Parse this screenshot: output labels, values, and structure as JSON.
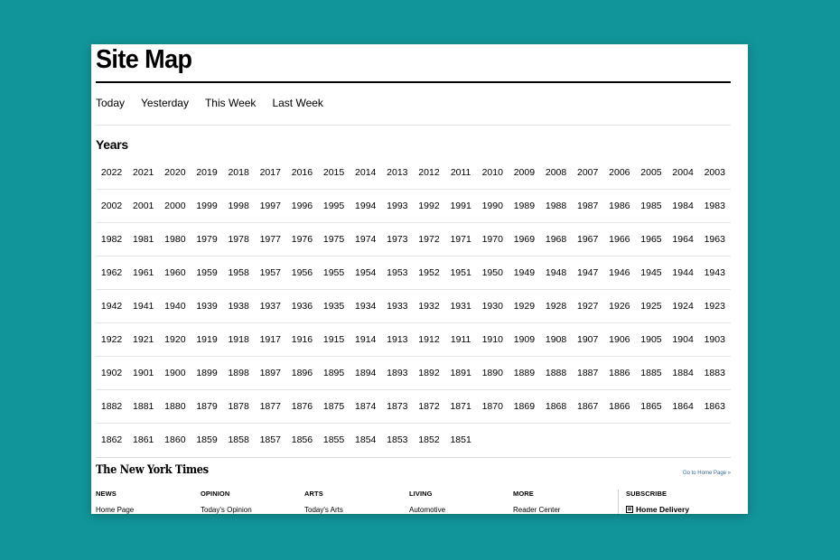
{
  "page": {
    "title": "Site Map"
  },
  "tabs": [
    "Today",
    "Yesterday",
    "This Week",
    "Last Week"
  ],
  "years_heading": "Years",
  "years": [
    [
      "2022",
      "2021",
      "2020",
      "2019",
      "2018",
      "2017",
      "2016",
      "2015",
      "2014",
      "2013",
      "2012",
      "2011",
      "2010",
      "2009",
      "2008",
      "2007",
      "2006",
      "2005",
      "2004",
      "2003"
    ],
    [
      "2002",
      "2001",
      "2000",
      "1999",
      "1998",
      "1997",
      "1996",
      "1995",
      "1994",
      "1993",
      "1992",
      "1991",
      "1990",
      "1989",
      "1988",
      "1987",
      "1986",
      "1985",
      "1984",
      "1983"
    ],
    [
      "1982",
      "1981",
      "1980",
      "1979",
      "1978",
      "1977",
      "1976",
      "1975",
      "1974",
      "1973",
      "1972",
      "1971",
      "1970",
      "1969",
      "1968",
      "1967",
      "1966",
      "1965",
      "1964",
      "1963"
    ],
    [
      "1962",
      "1961",
      "1960",
      "1959",
      "1958",
      "1957",
      "1956",
      "1955",
      "1954",
      "1953",
      "1952",
      "1951",
      "1950",
      "1949",
      "1948",
      "1947",
      "1946",
      "1945",
      "1944",
      "1943"
    ],
    [
      "1942",
      "1941",
      "1940",
      "1939",
      "1938",
      "1937",
      "1936",
      "1935",
      "1934",
      "1933",
      "1932",
      "1931",
      "1930",
      "1929",
      "1928",
      "1927",
      "1926",
      "1925",
      "1924",
      "1923"
    ],
    [
      "1922",
      "1921",
      "1920",
      "1919",
      "1918",
      "1917",
      "1916",
      "1915",
      "1914",
      "1913",
      "1912",
      "1911",
      "1910",
      "1909",
      "1908",
      "1907",
      "1906",
      "1905",
      "1904",
      "1903"
    ],
    [
      "1902",
      "1901",
      "1900",
      "1899",
      "1898",
      "1897",
      "1896",
      "1895",
      "1894",
      "1893",
      "1892",
      "1891",
      "1890",
      "1889",
      "1888",
      "1887",
      "1886",
      "1885",
      "1884",
      "1883"
    ],
    [
      "1882",
      "1881",
      "1880",
      "1879",
      "1878",
      "1877",
      "1876",
      "1875",
      "1874",
      "1873",
      "1872",
      "1871",
      "1870",
      "1869",
      "1868",
      "1867",
      "1866",
      "1865",
      "1864",
      "1863"
    ],
    [
      "1862",
      "1861",
      "1860",
      "1859",
      "1858",
      "1857",
      "1856",
      "1855",
      "1854",
      "1853",
      "1852",
      "1851"
    ]
  ],
  "footer": {
    "logo": "The New York Times",
    "home_link": "Go to Home Page »",
    "columns": [
      {
        "heading": "NEWS",
        "item": "Home Page"
      },
      {
        "heading": "OPINION",
        "item": "Today's Opinion"
      },
      {
        "heading": "ARTS",
        "item": "Today's Arts"
      },
      {
        "heading": "LIVING",
        "item": "Automotive"
      },
      {
        "heading": "MORE",
        "item": "Reader Center"
      }
    ],
    "subscribe": {
      "heading": "SUBSCRIBE",
      "item": "Home Delivery",
      "icon": "newspaper-icon"
    }
  }
}
